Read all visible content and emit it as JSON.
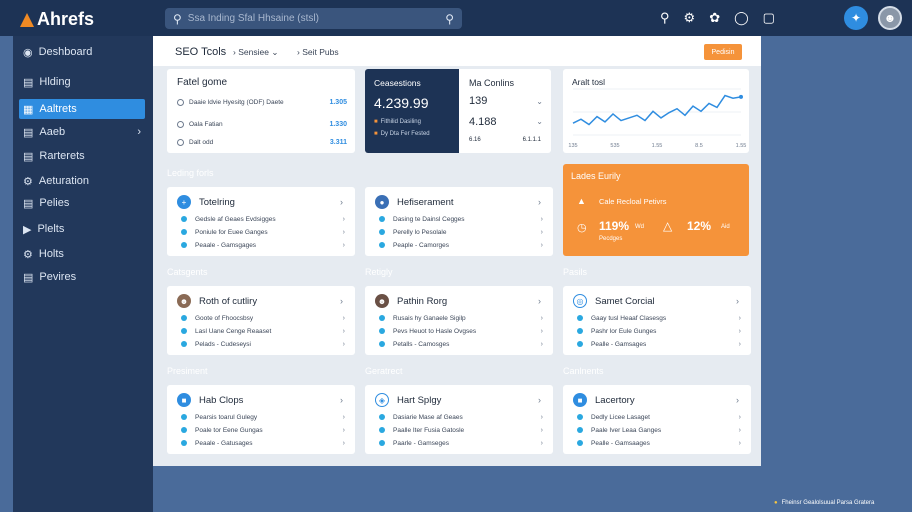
{
  "app": {
    "logo": "Ahrefs"
  },
  "search": {
    "placeholder": "Ssa Inding Sfal Hhsaine (stsl)"
  },
  "topbar": {
    "icons": [
      "search-icon",
      "settings-icon",
      "gift-icon",
      "help-icon",
      "doc-icon"
    ]
  },
  "sidebar": {
    "items": [
      {
        "label": "Deshboard",
        "icon": "dashboard-icon",
        "active": false
      },
      {
        "label": "Hlding",
        "icon": "holding-icon",
        "active": false
      },
      {
        "label": "Aaltrets",
        "icon": "alerts-icon",
        "active": true
      },
      {
        "label": "Aaeb",
        "icon": "web-icon",
        "active": false,
        "has_chevron": true
      },
      {
        "label": "Rarterets",
        "icon": "reports-icon",
        "active": false
      },
      {
        "label": "Aeturation",
        "icon": "automation-icon",
        "active": false
      },
      {
        "label": "Pelies",
        "icon": "policy-icon",
        "active": false
      },
      {
        "label": "Plelts",
        "icon": "plots-icon",
        "active": false
      },
      {
        "label": "Holts",
        "icon": "hosts-icon",
        "active": false
      },
      {
        "label": "Pevires",
        "icon": "reviews-icon",
        "active": false
      }
    ]
  },
  "subheader": {
    "title": "SEO Tcols",
    "crumb1": "Sensiee",
    "crumb2": "Seit Pubs",
    "button": "Pedisin"
  },
  "fatel_card": {
    "title": "Fatel gome",
    "rows": [
      {
        "label": "Daaie ldvie Hyesitg (ODF) Daete",
        "value": "1.305"
      },
      {
        "label": "Oala Fatian",
        "value": "1.330"
      },
      {
        "label": "Dalt odd",
        "value": "3.311"
      }
    ]
  },
  "stats_dark": {
    "title": "Ceasestions",
    "value": "4.239.99",
    "line1": "Fithilid Dasiling",
    "line2": "Dy Dta Fer Fested"
  },
  "stats_light": {
    "title": "Ma Conlins",
    "value1": "139",
    "value2": "4.188",
    "foot_left": "6.16",
    "foot_right": "6.1.1.1"
  },
  "chart_data": {
    "type": "line",
    "title": "Aralt tosl",
    "x": [
      "135",
      "",
      "535",
      "",
      "1.55",
      "",
      "8.5",
      "",
      "1.55"
    ],
    "series": [
      {
        "values": [
          18,
          24,
          16,
          28,
          20,
          32,
          22,
          26,
          30,
          22,
          36,
          26,
          34,
          40,
          30,
          44,
          36,
          48,
          42,
          60,
          56,
          58
        ]
      }
    ],
    "ylim": [
      0,
      70
    ],
    "color": "#2f8de0"
  },
  "sections": {
    "row1_left": "Leding forls",
    "row1_right": "Lades Eurily",
    "row2_a": "Catsgents",
    "row2_b": "Retigly",
    "row2_c": "Pasils",
    "row3_a": "Presiment",
    "row3_b": "Geratrect",
    "row3_c": "Canlnents"
  },
  "orange_card": {
    "subtitle": "Cale Recloal Petivrs",
    "stat1": "119%",
    "stat1_sub": "Pecdges",
    "stat1_suffix": "Wd",
    "stat2": "12%",
    "stat2_suffix": "Aid"
  },
  "feature_cards": [
    {
      "title": "Totelring",
      "icon": "plus-icon",
      "icon_color": "#ffffff",
      "lines": [
        "Gedsle af Geaes Evdsigges",
        "Poniule for Euee Ganges",
        "Peaale - Gamsgages"
      ]
    },
    {
      "title": "Hefiserament",
      "icon": "user-icon",
      "icon_color": "#3a6fb5",
      "lines": [
        "Dasing te Dainsl Cegges",
        "Perelly lo Pesolale",
        "Peaple - Camorges"
      ]
    },
    {
      "title": "Roth of cutliry",
      "icon": "avatar-icon",
      "icon_color": "#8a6a55",
      "lines": [
        "Goote of Fhoocsbsy",
        "Lasl Uane Cenge Reaaset",
        "Pelads - Cudeseysi"
      ]
    },
    {
      "title": "Pathin Rorg",
      "icon": "avatar-icon",
      "icon_color": "#6a5045",
      "lines": [
        "Rusais hy Ganaele Sigilp",
        "Pevs Heuot to Hasle Ovgses",
        "Petalls - Camosges"
      ]
    },
    {
      "title": "Samet Corcial",
      "icon": "globe-icon",
      "icon_color": "#ffffff",
      "lines": [
        "Gaay tusl Heaaf Clasesgs",
        "Pashr lor Eule Gunges",
        "Pealle - Gamsages"
      ]
    },
    {
      "title": "Hab Clops",
      "icon": "chat-icon",
      "icon_color": "#2f8de0",
      "lines": [
        "Pearsis toarul Gulegy",
        "Poale tor Eene Gungas",
        "Peaale - Gatusages"
      ]
    },
    {
      "title": "Hart Splgy",
      "icon": "bell-icon",
      "icon_color": "#ffffff",
      "lines": [
        "Dasiarie Mase af Geaes",
        "Paalle Iter Fusia Gatosle",
        "Paarle - Gamseges"
      ]
    },
    {
      "title": "Lacertory",
      "icon": "chat-icon",
      "icon_color": "#2f8de0",
      "lines": [
        "Dedly Licee Lasaget",
        "Paale Iver Leaa Ganges",
        "Pealle - Gamsaages"
      ]
    }
  ],
  "footer": {
    "note": "Fheinsr Gealolsuual Parsa Gratera"
  }
}
